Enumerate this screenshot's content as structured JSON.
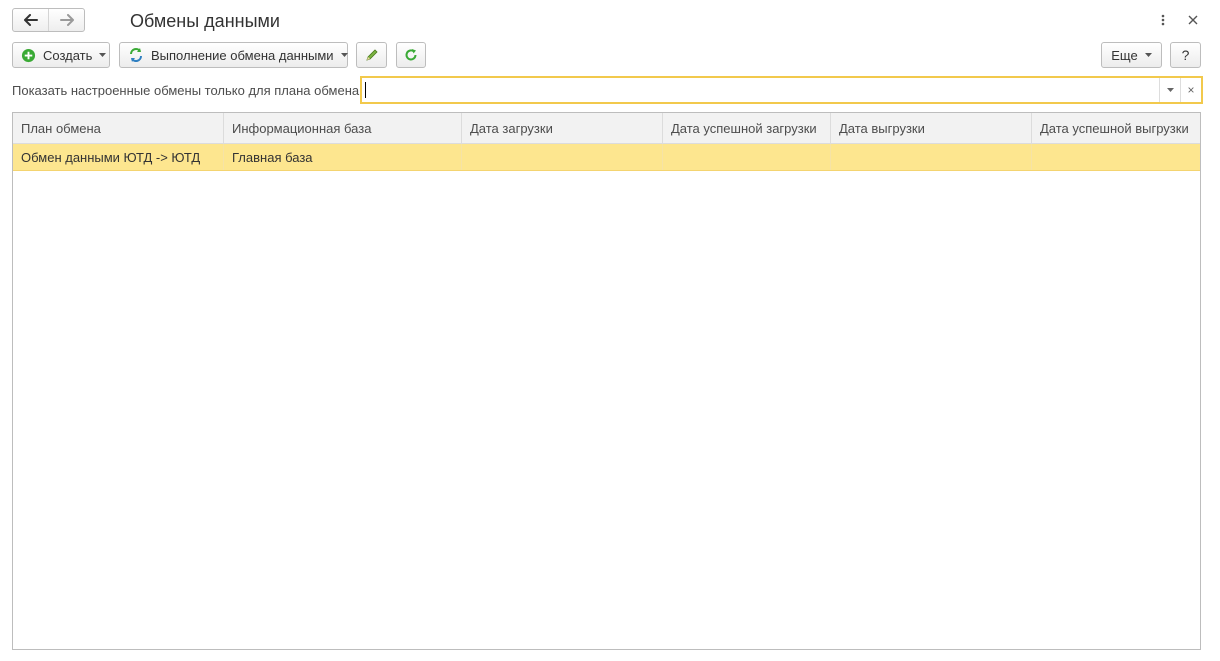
{
  "window": {
    "title": "Обмены данными"
  },
  "toolbar": {
    "create_label": "Создать",
    "exchange_label": "Выполнение обмена данными",
    "more_label": "Еще",
    "help_label": "?"
  },
  "filter": {
    "label": "Показать настроенные обмены только для плана обмена:",
    "value": "",
    "clear_label": "×"
  },
  "table": {
    "columns": [
      "План обмена",
      "Информационная база",
      "Дата загрузки",
      "Дата успешной загрузки",
      "Дата выгрузки",
      "Дата успешной выгрузки"
    ],
    "rows": [
      [
        "Обмен данными ЮТД -> ЮТД",
        "Главная база",
        "",
        "",
        "",
        ""
      ]
    ]
  },
  "colors": {
    "selected_row": "#fde68f",
    "field_focus": "#f2c94c",
    "create_icon": "#3aaa35",
    "refresh_icon": "#3aaa35"
  },
  "icons": {
    "back": "arrow-left-icon",
    "forward": "arrow-right-icon",
    "menu": "more-vertical-icon",
    "close": "close-icon",
    "create": "plus-circle-icon",
    "exchange": "sync-arrows-icon",
    "edit": "pencil-icon",
    "refresh": "refresh-icon"
  }
}
